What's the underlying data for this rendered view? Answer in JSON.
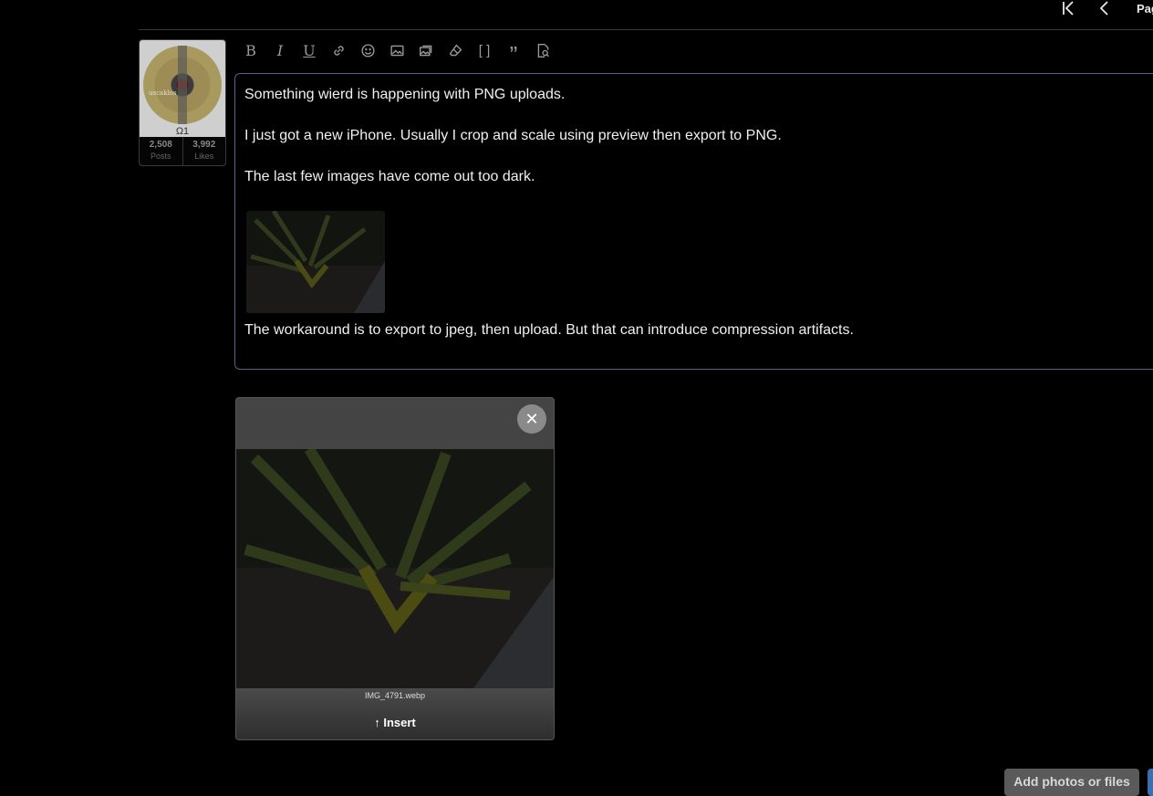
{
  "pagination": {
    "label": "Pag",
    "first_icon": "first-page-icon",
    "prev_icon": "prev-page-icon"
  },
  "user": {
    "handle": "Ω1",
    "posts_count": "2,508",
    "posts_label": "Posts",
    "likes_count": "3,992",
    "likes_label": "Likes",
    "avatar_text": "uscaklos"
  },
  "toolbar": {
    "icons": [
      "bold-icon",
      "italic-icon",
      "underline-icon",
      "link-icon",
      "emoji-icon",
      "image-icon",
      "media-icon",
      "clear-format-icon",
      "code-icon",
      "quote-icon",
      "preview-icon"
    ]
  },
  "editor": {
    "paragraphs": [
      "Something wierd is happening with PNG uploads.",
      "I just got a new iPhone.  Usually I crop and scale using preview then export to PNG.",
      "The last few images have come out too dark.",
      "The workaround is to export to jpeg, then upload.  But that can introduce compression artifacts."
    ]
  },
  "attachment": {
    "filename": "IMG_4791.webp",
    "insert_label": "↑ Insert",
    "close_glyph": "✕"
  },
  "actions": {
    "add_files_label": "Add photos or files"
  },
  "colors": {
    "background": "#000000",
    "editor_border": "#57608a",
    "accent": "#3a6fb0"
  }
}
